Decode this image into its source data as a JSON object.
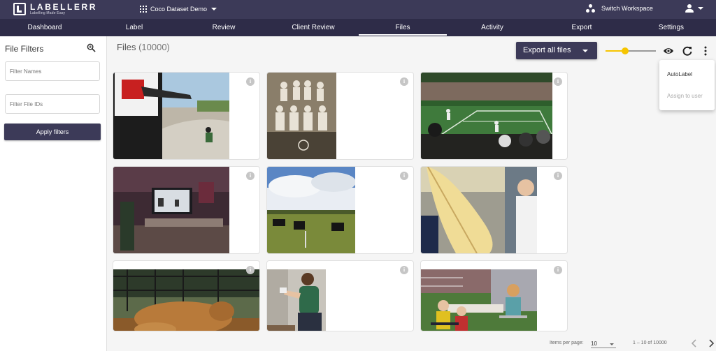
{
  "brand": {
    "name": "LABELLERR",
    "tagline": "Labelling Made Easy"
  },
  "header": {
    "dataset": "Coco Dataset Demo",
    "switch_workspace": "Switch Workspace"
  },
  "nav": {
    "tabs": [
      "Dashboard",
      "Label",
      "Review",
      "Client Review",
      "Files",
      "Activity",
      "Export",
      "Settings"
    ],
    "active": "Files"
  },
  "sidebar": {
    "title": "File Filters",
    "filter_names_placeholder": "Filter Names",
    "filter_ids_placeholder": "Filter File IDs",
    "apply_label": "Apply filters"
  },
  "main": {
    "title": "Files",
    "count": "(10000)",
    "export_label": "Export all files",
    "thumbnail_size_fraction": 0.38
  },
  "menu": {
    "autolabel": "AutoLabel",
    "assign": "Assign to user"
  },
  "files": [
    {
      "scene": "skatepark"
    },
    {
      "scene": "vintage tennis team photo"
    },
    {
      "scene": "tennis match"
    },
    {
      "scene": "living room with tv"
    },
    {
      "scene": "cows in field"
    },
    {
      "scene": "surfboard on bus"
    },
    {
      "scene": "cow in barn"
    },
    {
      "scene": "person playing video game"
    },
    {
      "scene": "children at table"
    }
  ],
  "footer": {
    "items_per_page_label": "Items per page:",
    "items_per_page": "10",
    "range": "1 – 10 of 10000"
  },
  "colors": {
    "topbar": "#3c3a58",
    "nav": "#2e2c48",
    "accent": "#f6c500"
  }
}
